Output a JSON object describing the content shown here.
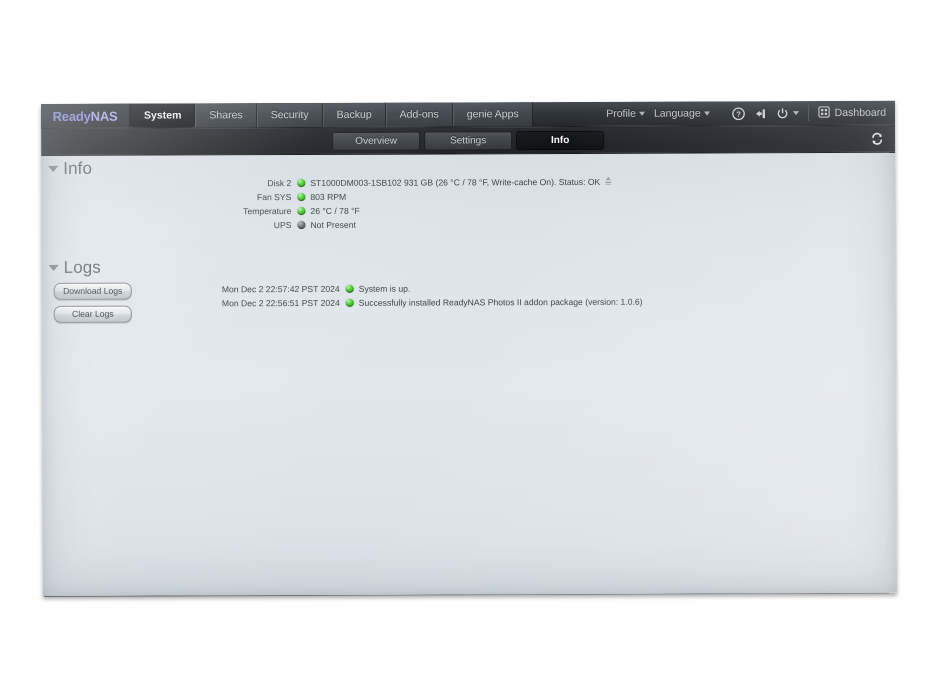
{
  "app": {
    "brand_ready": "Ready",
    "brand_nas": "NAS"
  },
  "topbar": {
    "tabs": [
      {
        "label": "System",
        "active": true
      },
      {
        "label": "Shares",
        "active": false
      },
      {
        "label": "Security",
        "active": false
      },
      {
        "label": "Backup",
        "active": false
      },
      {
        "label": "Add-ons",
        "active": false
      },
      {
        "label": "genie Apps",
        "active": false
      }
    ],
    "profile_label": "Profile",
    "language_label": "Language",
    "help_icon": "help-circle-icon",
    "logout_icon": "logout-icon",
    "power_icon": "power-icon",
    "dashboard_grid_icon": "grid-icon",
    "dashboard_label": "Dashboard"
  },
  "subbar": {
    "tabs": [
      {
        "label": "Overview",
        "active": false
      },
      {
        "label": "Settings",
        "active": false
      },
      {
        "label": "Info",
        "active": true
      }
    ],
    "refresh_icon": "refresh-icon"
  },
  "info_section": {
    "title": "Info",
    "rows": [
      {
        "label": "Disk 2",
        "status": "green",
        "value": "ST1000DM003-1SB102 931 GB (26 °C / 78 °F, Write-cache On). Status: OK",
        "trailing_icon": "disk-eject-icon"
      },
      {
        "label": "Fan SYS",
        "status": "green",
        "value": "803 RPM",
        "trailing_icon": ""
      },
      {
        "label": "Temperature",
        "status": "green",
        "value": "26 °C / 78 °F",
        "trailing_icon": ""
      },
      {
        "label": "UPS",
        "status": "gray",
        "value": "Not Present",
        "trailing_icon": ""
      }
    ]
  },
  "logs_section": {
    "title": "Logs",
    "download_label": "Download Logs",
    "clear_label": "Clear Logs",
    "entries": [
      {
        "time": "Mon Dec 2 22:57:42 PST 2024",
        "status": "green",
        "message": "System is up."
      },
      {
        "time": "Mon Dec 2 22:56:51 PST 2024",
        "status": "green",
        "message": "Successfully installed ReadyNAS Photos II addon package (version: 1.0.6)"
      }
    ]
  },
  "colors": {
    "brand_purple": "#8a8ede",
    "status_ok": "#49d22f",
    "status_off": "#6c7276",
    "topbar_bg": "#2c3034",
    "content_bg": "#dfe5ea"
  }
}
